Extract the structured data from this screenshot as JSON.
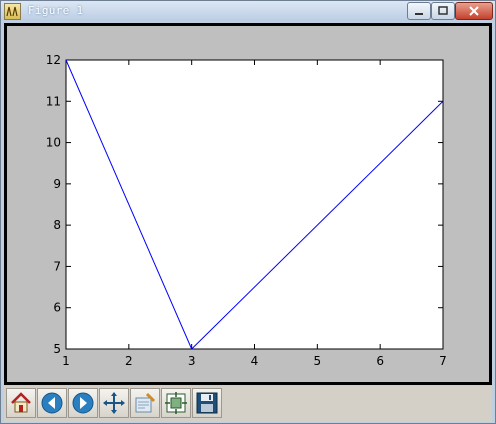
{
  "window": {
    "title": "Figure 1"
  },
  "toolbar": {
    "buttons": [
      {
        "name": "home-button",
        "icon": "home-icon"
      },
      {
        "name": "back-button",
        "icon": "back-arrow-icon"
      },
      {
        "name": "forward-button",
        "icon": "forward-arrow-icon"
      },
      {
        "name": "pan-button",
        "icon": "move-arrows-icon"
      },
      {
        "name": "zoom-button",
        "icon": "zoom-rectangle-icon"
      },
      {
        "name": "configure-subplots-button",
        "icon": "subplots-icon"
      },
      {
        "name": "save-button",
        "icon": "floppy-disk-icon"
      }
    ]
  },
  "colors": {
    "line": "#0000ff",
    "figure_background": "#bfbfbf",
    "axes_background": "#ffffff"
  },
  "chart_data": {
    "type": "line",
    "title": "",
    "xlabel": "",
    "ylabel": "",
    "x": [
      1,
      3,
      7
    ],
    "y": [
      12,
      5,
      11
    ],
    "xlim": [
      1,
      7
    ],
    "ylim": [
      5,
      12
    ],
    "xticks": [
      "1",
      "2",
      "3",
      "4",
      "5",
      "6",
      "7"
    ],
    "yticks": [
      "5",
      "6",
      "7",
      "8",
      "9",
      "10",
      "11",
      "12"
    ],
    "grid": false
  }
}
